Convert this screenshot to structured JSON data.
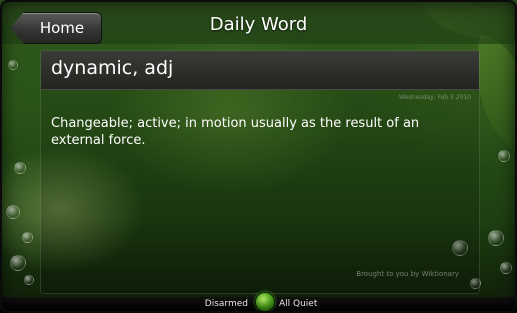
{
  "header": {
    "home_label": "Home",
    "title": "Daily Word"
  },
  "word": {
    "heading": "dynamic, adj",
    "date": "Wednesday, Feb 3 2010",
    "definition": "Changeable; active; in motion usually as the result of an external force.",
    "attribution": "Brought to you by Wiktionary"
  },
  "status": {
    "left_label": "Disarmed",
    "right_label": "All Quiet",
    "indicator_color": "#4ca21a"
  },
  "theme": {
    "background": "#2a5318",
    "accent": "#4ca21a"
  }
}
